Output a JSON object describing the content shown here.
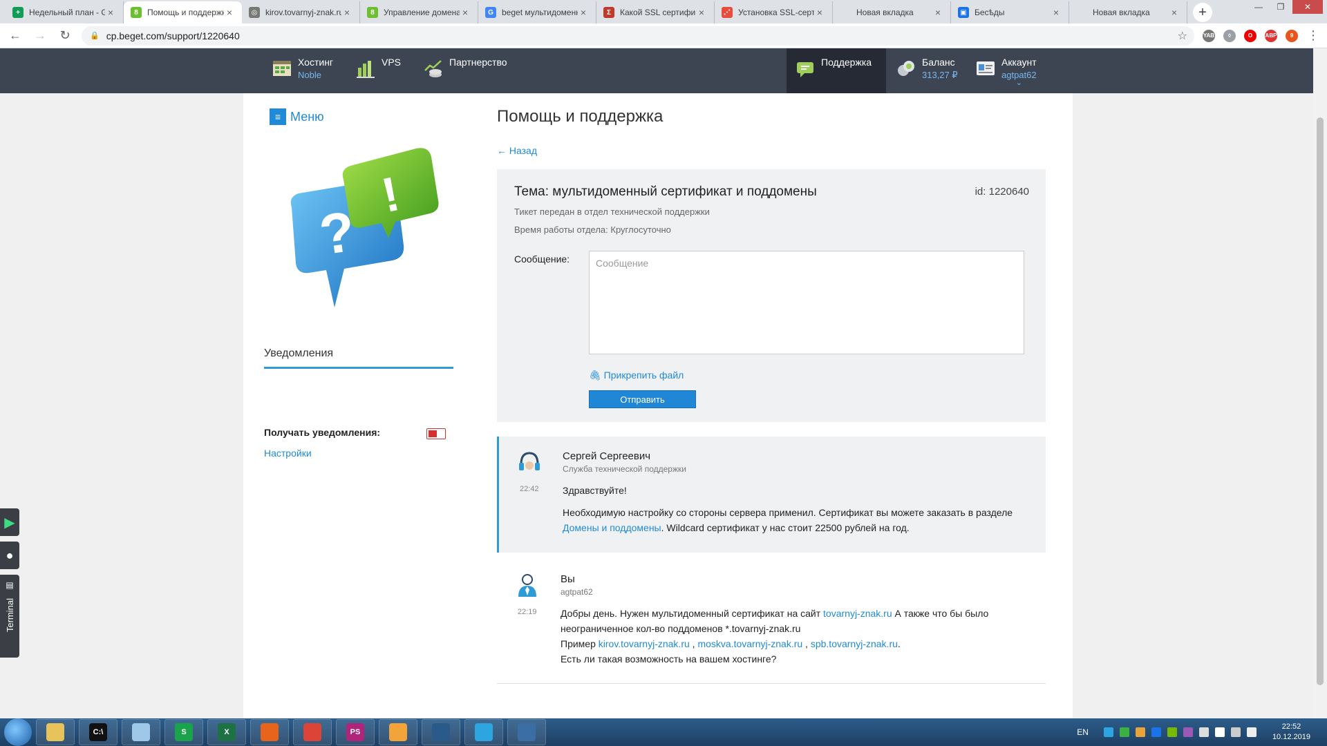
{
  "browser": {
    "tabs": [
      {
        "title": "Недельный план - Google",
        "favicon": "sheets-icon",
        "color": "#0f9d58",
        "glyph": "+",
        "active": false
      },
      {
        "title": "Помощь и поддержка",
        "favicon": "beget-icon",
        "color": "#6cbf2f",
        "glyph": "8",
        "active": true
      },
      {
        "title": "kirov.tovarnyj-znak.ru",
        "favicon": "globe-icon",
        "color": "#777777",
        "glyph": "◎",
        "active": false
      },
      {
        "title": "Управление доменами",
        "favicon": "beget-icon",
        "color": "#6cbf2f",
        "glyph": "8",
        "active": false
      },
      {
        "title": "beget мультидоменный",
        "favicon": "google-icon",
        "color": "#4285f4",
        "glyph": "G",
        "active": false
      },
      {
        "title": "Какой SSL сертификат",
        "favicon": "sigma-icon",
        "color": "#c0392b",
        "glyph": "Σ",
        "active": false
      },
      {
        "title": "Установка SSL-сертификата",
        "favicon": "chart-icon",
        "color": "#e74c3c",
        "glyph": "⋰",
        "active": false
      },
      {
        "title": "Новая вкладка",
        "favicon": "",
        "color": "#dee1e6",
        "glyph": "",
        "active": false
      },
      {
        "title": "Бесѣды",
        "favicon": "chat-icon",
        "color": "#1a73e8",
        "glyph": "▣",
        "active": false
      },
      {
        "title": "Новая вкладка",
        "favicon": "",
        "color": "#dee1e6",
        "glyph": "",
        "active": false
      }
    ],
    "url": "cp.beget.com/support/1220640",
    "ext_badge": "9"
  },
  "nav": {
    "hosting_label": "Хостинг",
    "hosting_plan": "Noble",
    "vps_label": "VPS",
    "partner_label": "Партнерство",
    "support_label": "Поддержка",
    "balance_label": "Баланс",
    "balance_value": "313,27 ₽",
    "account_label": "Аккаунт",
    "account_value": "agtpat62",
    "account_caret": "⌄"
  },
  "sidebar": {
    "menu_label": "Меню",
    "notifications_title": "Уведомления",
    "receive_label": "Получать уведомления:",
    "settings_link": "Настройки"
  },
  "page": {
    "title": "Помощь и поддержка",
    "back_link": "← Назад"
  },
  "ticket": {
    "subject": "Тема: мультидоменный сертификат и поддомены",
    "id": "id: 1220640",
    "status": "Тикет передан в отдел технической поддержки",
    "hours": "Время работы отдела: Круглосуточно",
    "message_label": "Сообщение:",
    "message_placeholder": "Сообщение",
    "attach_label": "Прикрепить файл",
    "send_label": "Отправить"
  },
  "messages": [
    {
      "author": "Сергей Сергеевич",
      "role": "Служба технической поддержки",
      "time": "22:42",
      "greeting": "Здравствуйте!",
      "text_before": "Необходимую настройку со стороны сервера применил. Сертификат вы можете заказать в разделе ",
      "link": "Домены и поддомены",
      "text_after": ". Wildcard сертификат у нас стоит 22500 рублей на год."
    },
    {
      "author": "Вы",
      "role": "agtpat62",
      "time": "22:19",
      "line1_before": "Добры день. Нужен мультидоменный сертификат на сайт  ",
      "line1_link": "tovarnyj-znak.ru",
      "line1_after": " А также что бы было неограниченное кол-во поддоменов *.tovarnyj-znak.ru",
      "line2_before": "Пример ",
      "line2_link1": "kirov.tovarnyj-znak.ru",
      "line2_sep1": " , ",
      "line2_link2": "moskva.tovarnyj-znak.ru",
      "line2_sep2": " , ",
      "line2_link3": "spb.tovarnyj-znak.ru",
      "line2_after": ".",
      "line3": "Есть ли такая возможность на вашем хостинге?"
    }
  ],
  "dock": {
    "terminal_label": "Terminal"
  },
  "taskbar": {
    "apps": [
      {
        "name": "explorer-icon",
        "label": "",
        "color": "#e8c35a"
      },
      {
        "name": "cmd-icon",
        "label": "C:\\",
        "color": "#111111"
      },
      {
        "name": "notes-icon",
        "label": "",
        "color": "#9fc7e8"
      },
      {
        "name": "skype-icon",
        "label": "S",
        "color": "#1aa34a"
      },
      {
        "name": "excel-icon",
        "label": "X",
        "color": "#1d7145"
      },
      {
        "name": "firefox-icon",
        "label": "",
        "color": "#e8641c"
      },
      {
        "name": "chrome-icon",
        "label": "",
        "color": "#db4437"
      },
      {
        "name": "phpstorm-icon",
        "label": "PS",
        "color": "#b0247a"
      },
      {
        "name": "picasa-icon",
        "label": "",
        "color": "#f2a33a"
      },
      {
        "name": "mysql-icon",
        "label": "",
        "color": "#2a5a8a"
      },
      {
        "name": "telegram-icon",
        "label": "",
        "color": "#2ca5e0"
      },
      {
        "name": "network-icon",
        "label": "",
        "color": "#3a6ea5"
      }
    ],
    "lang": "EN",
    "time": "22:52",
    "date": "10.12.2019"
  },
  "colors": {
    "accent": "#1f8ad8",
    "nav_bg": "#3d4452",
    "toggle_off": "#d62f2f"
  }
}
